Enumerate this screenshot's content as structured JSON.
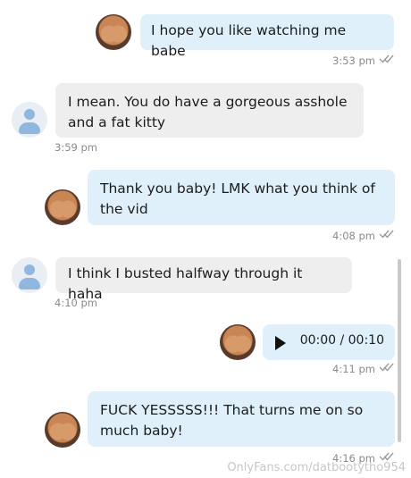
{
  "messages": [
    {
      "text": "I hope you like watching me babe",
      "time": "3:53 pm"
    },
    {
      "text": "I mean. You do have a gorgeous asshole and a fat kitty",
      "time": "3:59 pm"
    },
    {
      "text": "Thank you baby! LMK what you think of the vid",
      "time": "4:08 pm"
    },
    {
      "text": "I think I busted halfway through it haha",
      "time": "4:10 pm"
    },
    {
      "audio_time": "00:00 / 00:10",
      "time": "4:11 pm"
    },
    {
      "text": "FUCK YESSSSS!!! That turns me on so much baby!",
      "time": "4:16 pm"
    }
  ],
  "watermark": "OnlyFans.com/datbootytho954",
  "icons": {
    "sent_status": "double-check-icon",
    "play": "play-icon",
    "default_avatar": "user-avatar-icon"
  }
}
